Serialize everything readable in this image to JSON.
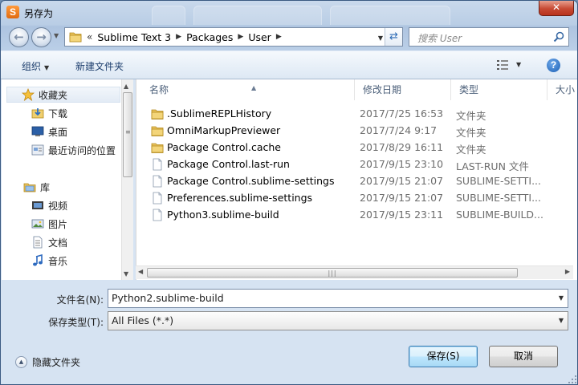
{
  "window": {
    "title": "另存为",
    "app_icon_letter": "S",
    "close_label": "✕"
  },
  "nav": {
    "back_icon": "back-arrow-icon",
    "forward_icon": "forward-arrow-icon",
    "breadcrumb_prefix": "«",
    "breadcrumbs": [
      "Sublime Text 3",
      "Packages",
      "User"
    ],
    "search_placeholder": "搜索 User"
  },
  "toolbar": {
    "organize": "组织",
    "new_folder": "新建文件夹",
    "help": "?"
  },
  "sidebar": {
    "favorites": {
      "label": "收藏夹",
      "items": [
        "下载",
        "桌面",
        "最近访问的位置"
      ]
    },
    "libraries": {
      "label": "库",
      "items": [
        "视频",
        "图片",
        "文档",
        "音乐"
      ]
    }
  },
  "columns": {
    "name": "名称",
    "date": "修改日期",
    "type": "类型",
    "size": "大小"
  },
  "files": [
    {
      "name": ".SublimeREPLHistory",
      "date": "2017/7/25 16:53",
      "type": "文件夹",
      "kind": "folder"
    },
    {
      "name": "OmniMarkupPreviewer",
      "date": "2017/7/24 9:17",
      "type": "文件夹",
      "kind": "folder"
    },
    {
      "name": "Package Control.cache",
      "date": "2017/8/29 16:11",
      "type": "文件夹",
      "kind": "folder"
    },
    {
      "name": "Package Control.last-run",
      "date": "2017/9/15 23:10",
      "type": "LAST-RUN 文件",
      "kind": "file"
    },
    {
      "name": "Package Control.sublime-settings",
      "date": "2017/9/15 21:07",
      "type": "SUBLIME-SETTI...",
      "kind": "file"
    },
    {
      "name": "Preferences.sublime-settings",
      "date": "2017/9/15 21:07",
      "type": "SUBLIME-SETTI...",
      "kind": "file"
    },
    {
      "name": "Python3.sublime-build",
      "date": "2017/9/15 23:11",
      "type": "SUBLIME-BUILD...",
      "kind": "file"
    }
  ],
  "form": {
    "filename_label": "文件名(N):",
    "filename_value": "Python2.sublime-build",
    "filetype_label": "保存类型(T):",
    "filetype_value": "All Files (*.*)",
    "hide_folders": "隐藏文件夹",
    "save": "保存(S)",
    "cancel": "取消"
  },
  "colors": {
    "title_bar": "#b9cde5",
    "close_red": "#c74a34",
    "folder_yellow": "#e8c15a",
    "form_bg": "#d6e3f2"
  }
}
